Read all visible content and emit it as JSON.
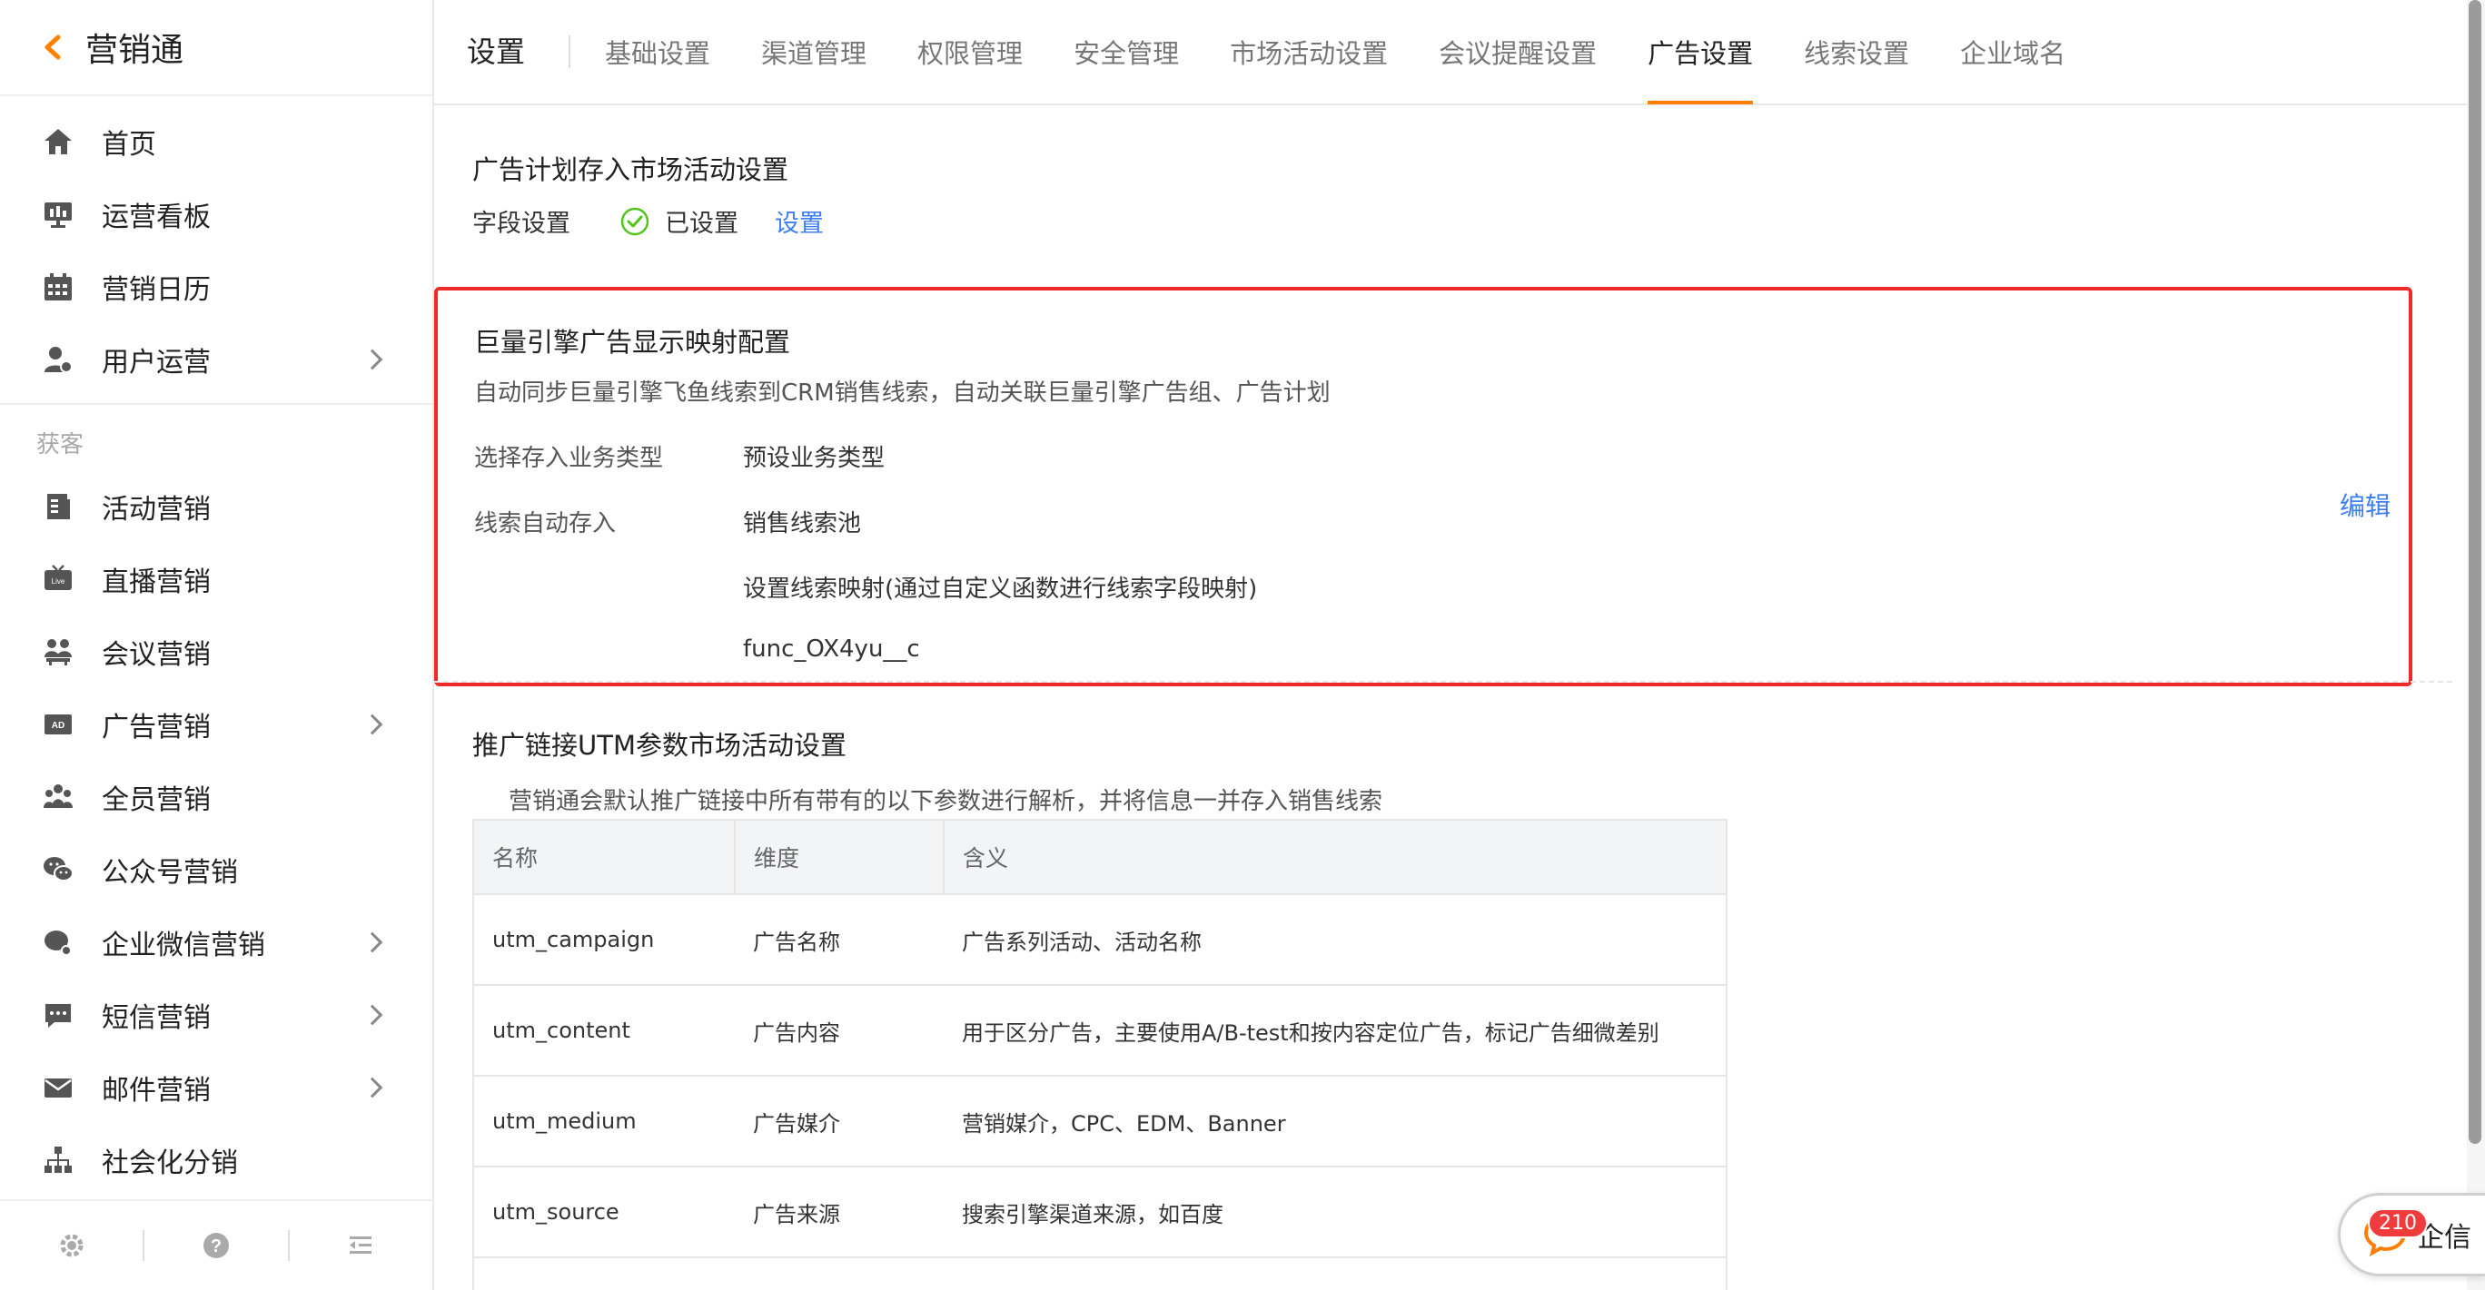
{
  "sidebar": {
    "brand_title": "营销通",
    "items": [
      {
        "label": "首页",
        "icon": "home-icon"
      },
      {
        "label": "运营看板",
        "icon": "dashboard-icon"
      },
      {
        "label": "营销日历",
        "icon": "calendar-icon"
      },
      {
        "label": "用户运营",
        "icon": "user-icon"
      }
    ],
    "section_title": "获客",
    "items2": [
      {
        "label": "活动营销",
        "icon": "document-icon"
      },
      {
        "label": "直播营销",
        "icon": "live-icon"
      },
      {
        "label": "会议营销",
        "icon": "meeting-icon"
      },
      {
        "label": "广告营销",
        "icon": "ad-icon"
      },
      {
        "label": "全员营销",
        "icon": "team-icon"
      },
      {
        "label": "公众号营销",
        "icon": "wechat-icon"
      },
      {
        "label": "企业微信营销",
        "icon": "work-wechat-icon"
      },
      {
        "label": "短信营销",
        "icon": "sms-icon"
      },
      {
        "label": "邮件营销",
        "icon": "mail-icon"
      },
      {
        "label": "社会化分销",
        "icon": "hierarchy-icon"
      }
    ]
  },
  "topbar": {
    "title": "设置",
    "tabs": [
      "基础设置",
      "渠道管理",
      "权限管理",
      "安全管理",
      "市场活动设置",
      "会议提醒设置",
      "广告设置",
      "线索设置",
      "企业域名"
    ],
    "active_tab": "广告设置"
  },
  "section1": {
    "title": "广告计划存入市场活动设置",
    "field_label": "字段设置",
    "status": "已设置",
    "action": "设置"
  },
  "section2": {
    "title": "巨量引擎广告显示映射配置",
    "desc": "自动同步巨量引擎飞鱼线索到CRM销售线索，自动关联巨量引擎广告组、广告计划",
    "label_type": "选择存入业务类型",
    "value_type": "预设业务类型",
    "label_auto": "线索自动存入",
    "value_pool": "销售线索池",
    "value_mapping": "设置线索映射(通过自定义函数进行线索字段映射)",
    "value_func": "func_OX4yu__c",
    "edit": "编辑"
  },
  "section3": {
    "title": "推广链接UTM参数市场活动设置",
    "desc": "营销通会默认推广链接中所有带有的以下参数进行解析，并将信息一并存入销售线索",
    "headers": [
      "名称",
      "维度",
      "含义"
    ],
    "rows": [
      [
        "utm_campaign",
        "广告名称",
        "广告系列活动、活动名称"
      ],
      [
        "utm_content",
        "广告内容",
        "用于区分广告，主要使用A/B-test和按内容定位广告，标记广告细微差别"
      ],
      [
        "utm_medium",
        "广告媒介",
        "营销媒介，CPC、EDM、Banner"
      ],
      [
        "utm_source",
        "广告来源",
        "搜索引擎渠道来源，如百度"
      ]
    ]
  },
  "chat": {
    "badge": "210",
    "label": "企信"
  },
  "colors": {
    "accent": "#ff8000",
    "link": "#3d7ef3",
    "highlight_border": "#ee2a2a",
    "success": "#52c41a"
  }
}
